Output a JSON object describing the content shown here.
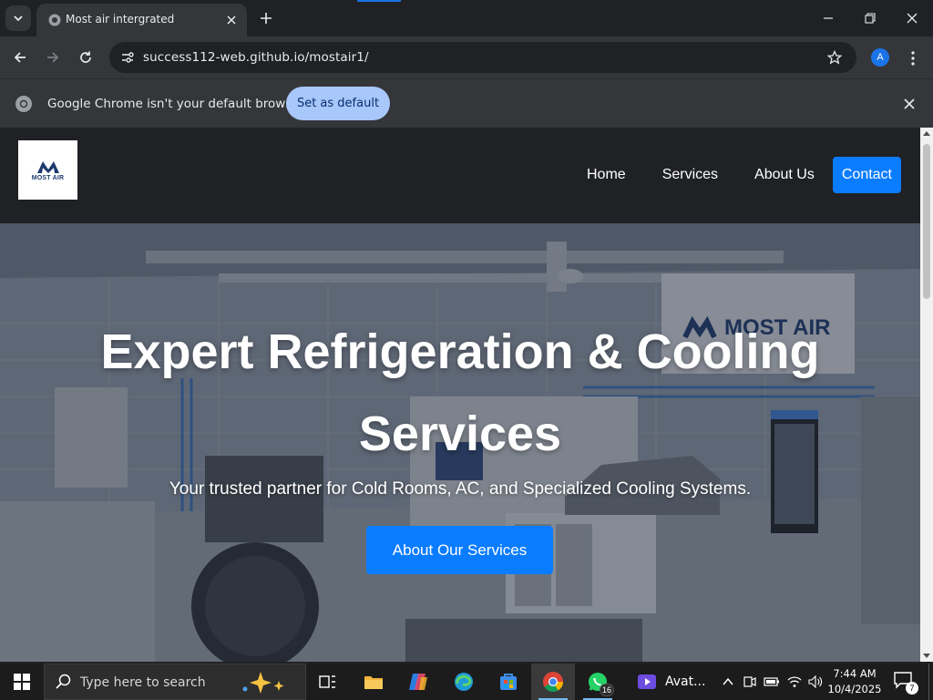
{
  "browser": {
    "tab_title": "Most air intergrated",
    "url": "success112-web.github.io/mostair1/",
    "profile_initial": "A",
    "infobar_message": "Google Chrome isn't your default browser",
    "infobar_button": "Set as default"
  },
  "site": {
    "logo_text": "MOST AIR",
    "nav": [
      "Home",
      "Services",
      "About Us",
      "Contact"
    ],
    "hero_title_line1": "Expert Refrigeration & Cooling",
    "hero_title_line2": "Services",
    "hero_subtitle": "Your trusted partner for Cold Rooms, AC, and Specialized Cooling Systems.",
    "hero_button": "About Our Services",
    "hero_sign_text": "MOST AIR",
    "accent_color": "#0a7cff"
  },
  "taskbar": {
    "search_placeholder": "Type here to search",
    "whatsapp_badge": "16",
    "avat_label": "Avat...",
    "time": "7:44 AM",
    "date": "10/4/2025",
    "notification_count": "7"
  }
}
